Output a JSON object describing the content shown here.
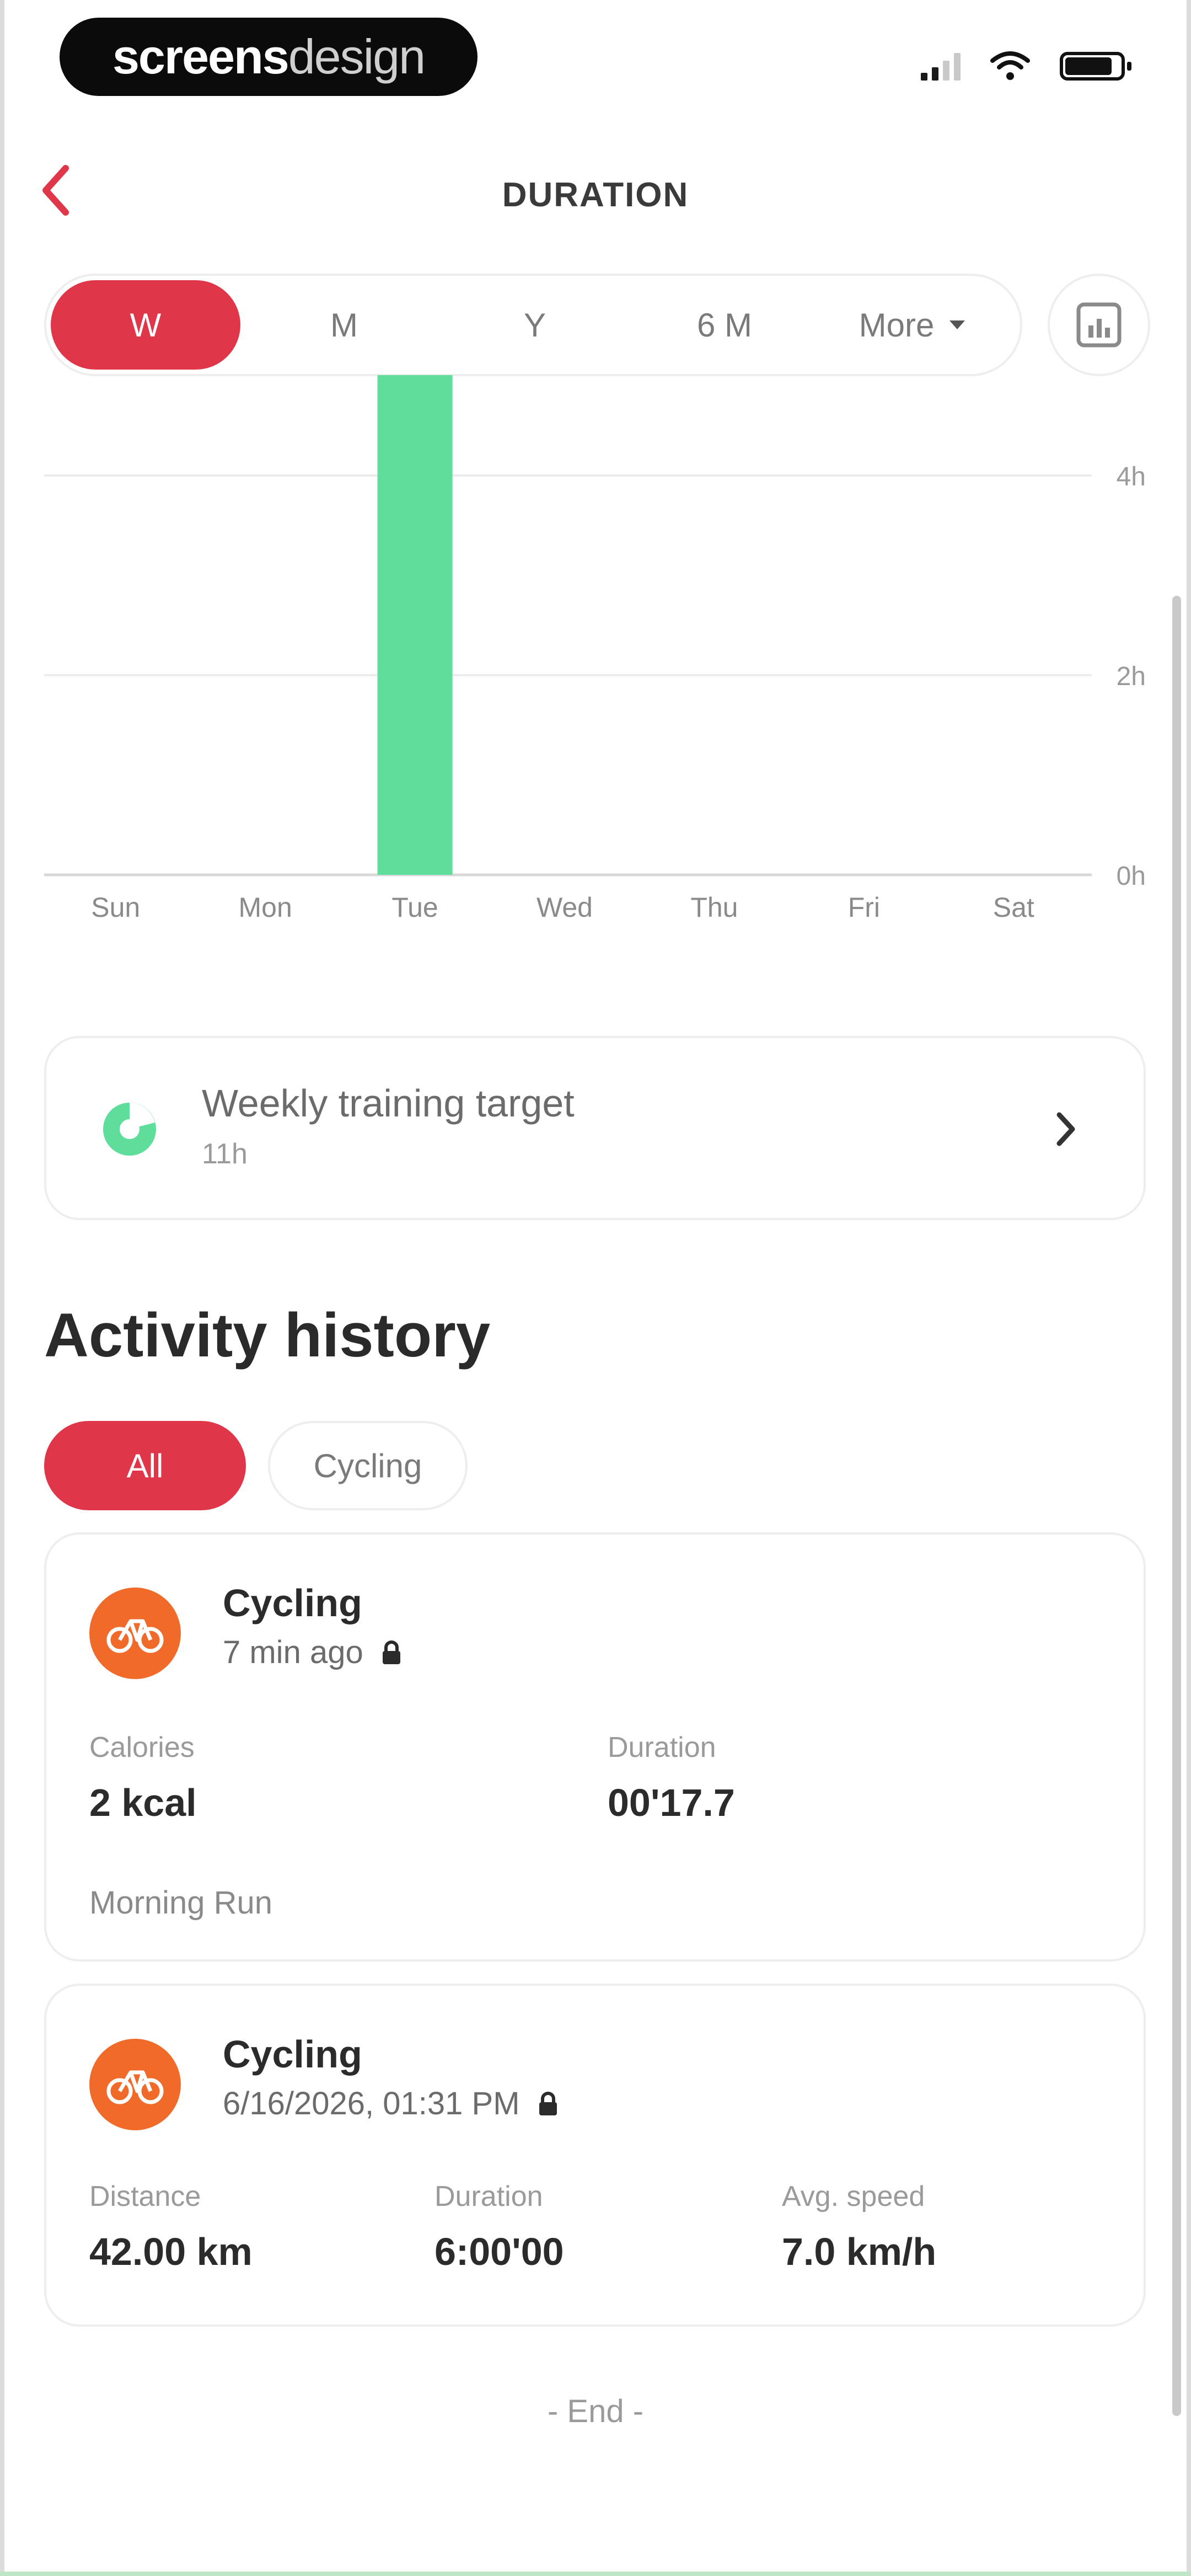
{
  "brand": {
    "part1": "screens",
    "part2": "design"
  },
  "header": {
    "title": "DURATION"
  },
  "periods": [
    {
      "label": "W",
      "active": true
    },
    {
      "label": "M",
      "active": false
    },
    {
      "label": "Y",
      "active": false
    },
    {
      "label": "6 M",
      "active": false
    },
    {
      "label": "More",
      "active": false
    }
  ],
  "chart_data": {
    "type": "bar",
    "categories": [
      "Sun",
      "Mon",
      "Tue",
      "Wed",
      "Thu",
      "Fri",
      "Sat"
    ],
    "values": [
      0,
      0,
      6,
      0,
      0,
      0,
      0
    ],
    "y_ticks": [
      "0h",
      "2h",
      "4h"
    ],
    "ylim": [
      0,
      5
    ],
    "grid": true,
    "bar_color": "#5ede9a"
  },
  "target": {
    "title": "Weekly training target",
    "subtitle": "11h"
  },
  "history": {
    "title": "Activity history",
    "filters": [
      "All",
      "Cycling"
    ],
    "items": [
      {
        "title": "Cycling",
        "time": "7 min ago",
        "metrics": [
          {
            "label": "Calories",
            "value": "2 kcal"
          },
          {
            "label": "Duration",
            "value": "00'17.7"
          }
        ],
        "note": "Morning Run"
      },
      {
        "title": "Cycling",
        "time": "6/16/2026, 01:31 PM",
        "metrics": [
          {
            "label": "Distance",
            "value": "42.00 km"
          },
          {
            "label": "Duration",
            "value": "6:00'00"
          },
          {
            "label": "Avg. speed",
            "value": "7.0 km/h"
          }
        ]
      }
    ],
    "end_label": "- End -"
  },
  "colors": {
    "accent": "#e0364a",
    "activity": "#f06a2a",
    "target_green": "#5ede9a"
  }
}
